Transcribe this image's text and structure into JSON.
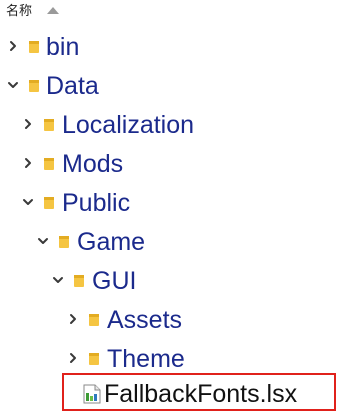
{
  "header": {
    "column_name": "名称",
    "sort_icon": "sort-ascending-icon"
  },
  "tree": {
    "items": [
      {
        "label": "bin",
        "expanded": false,
        "type": "folder",
        "icon": "folder-icon"
      },
      {
        "label": "Data",
        "expanded": true,
        "type": "folder",
        "icon": "folder-icon"
      },
      {
        "label": "Localization",
        "expanded": false,
        "type": "folder",
        "icon": "folder-icon"
      },
      {
        "label": "Mods",
        "expanded": false,
        "type": "folder",
        "icon": "folder-icon"
      },
      {
        "label": "Public",
        "expanded": true,
        "type": "folder",
        "icon": "folder-icon"
      },
      {
        "label": "Game",
        "expanded": true,
        "type": "folder",
        "icon": "folder-icon"
      },
      {
        "label": "GUI",
        "expanded": true,
        "type": "folder",
        "icon": "folder-icon"
      },
      {
        "label": "Assets",
        "expanded": false,
        "type": "folder",
        "icon": "folder-icon"
      },
      {
        "label": "Theme",
        "expanded": false,
        "type": "folder",
        "icon": "folder-icon"
      },
      {
        "label": "FallbackFonts.lsx",
        "type": "file",
        "icon": "lsx-file-icon",
        "highlighted": true
      }
    ]
  },
  "colors": {
    "folder_label": "#1b2a8c",
    "file_label": "#111111",
    "chevron": "#3a3a3a",
    "folder_fill": "#f5c542",
    "highlight_border": "#e0211b"
  }
}
